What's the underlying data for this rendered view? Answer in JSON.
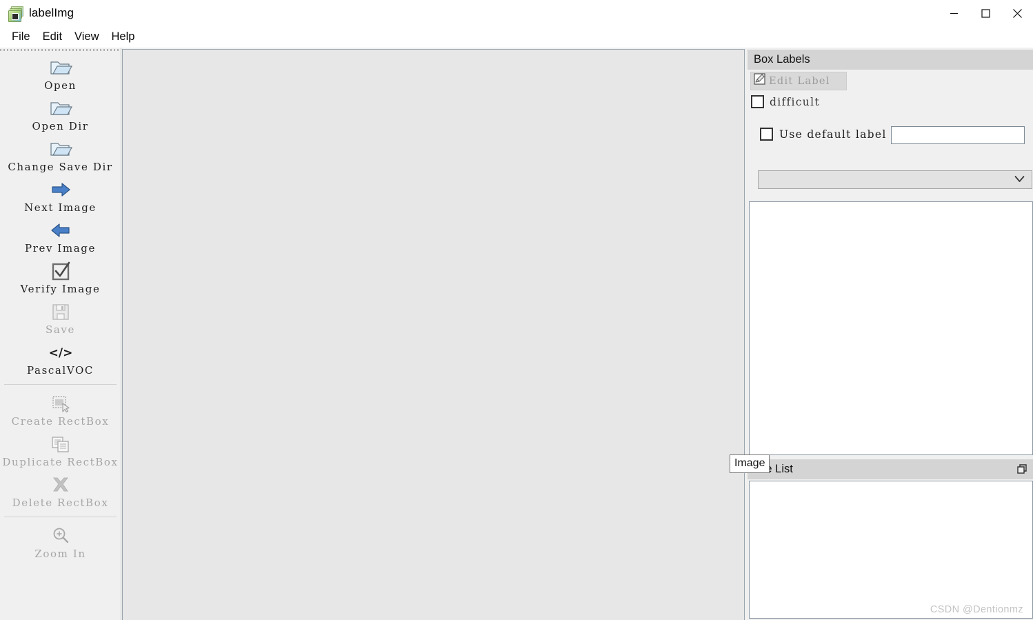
{
  "window": {
    "title": "labelImg",
    "icon": "labelimg-app-icon",
    "controls": {
      "minimize": "minimize-icon",
      "maximize": "maximize-icon",
      "close": "close-icon"
    }
  },
  "menubar": {
    "items": [
      {
        "label": "File"
      },
      {
        "label": "Edit"
      },
      {
        "label": "View"
      },
      {
        "label": "Help"
      }
    ]
  },
  "toolbar": {
    "groups": [
      {
        "items": [
          {
            "label": "Open",
            "icon": "open-folder-icon",
            "enabled": true
          },
          {
            "label": "Open Dir",
            "icon": "open-folder-icon",
            "enabled": true
          },
          {
            "label": "Change Save Dir",
            "icon": "open-folder-icon",
            "enabled": true
          },
          {
            "label": "Next Image",
            "icon": "arrow-right-icon",
            "enabled": true
          },
          {
            "label": "Prev Image",
            "icon": "arrow-left-icon",
            "enabled": true
          },
          {
            "label": "Verify Image",
            "icon": "checkbox-check-icon",
            "enabled": true
          },
          {
            "label": "Save",
            "icon": "floppy-disk-icon",
            "enabled": false
          },
          {
            "label": "PascalVOC",
            "icon": "code-tags-icon",
            "enabled": true
          }
        ]
      },
      {
        "items": [
          {
            "label": "Create RectBox",
            "icon": "create-rectbox-icon",
            "enabled": false
          },
          {
            "label": "Duplicate RectBox",
            "icon": "duplicate-rectbox-icon",
            "enabled": false
          },
          {
            "label": "Delete RectBox",
            "icon": "delete-cross-icon",
            "enabled": false
          }
        ]
      },
      {
        "items": [
          {
            "label": "Zoom In",
            "icon": "zoom-in-magnifier-icon",
            "enabled": false
          }
        ]
      }
    ]
  },
  "box_labels_dock": {
    "title": "Box Labels",
    "edit_label_button": {
      "label": "Edit Label",
      "icon": "edit-pencil-icon",
      "enabled": false
    },
    "difficult_checkbox": {
      "label": "difficult",
      "checked": false
    },
    "use_default_label_checkbox": {
      "label": "Use default label",
      "checked": false
    },
    "default_label_input": {
      "value": "",
      "placeholder": ""
    },
    "label_combo": {
      "value": "",
      "icon": "chevron-down-icon"
    },
    "label_list_items": []
  },
  "file_list_dock": {
    "title": "File List",
    "float_button_icon": "float-undock-icon",
    "items": []
  },
  "tooltip": {
    "text": "Image"
  },
  "watermark": {
    "text": "CSDN @Dentionmz"
  },
  "colors": {
    "window_bg": "#ffffff",
    "panel_bg": "#f0f0f0",
    "canvas_bg": "#e7e7e7",
    "dock_title_bg": "#d4d4d4",
    "list_bg": "#ffffff",
    "disabled_text": "#a6a6a6",
    "border": "#8a96a1"
  }
}
